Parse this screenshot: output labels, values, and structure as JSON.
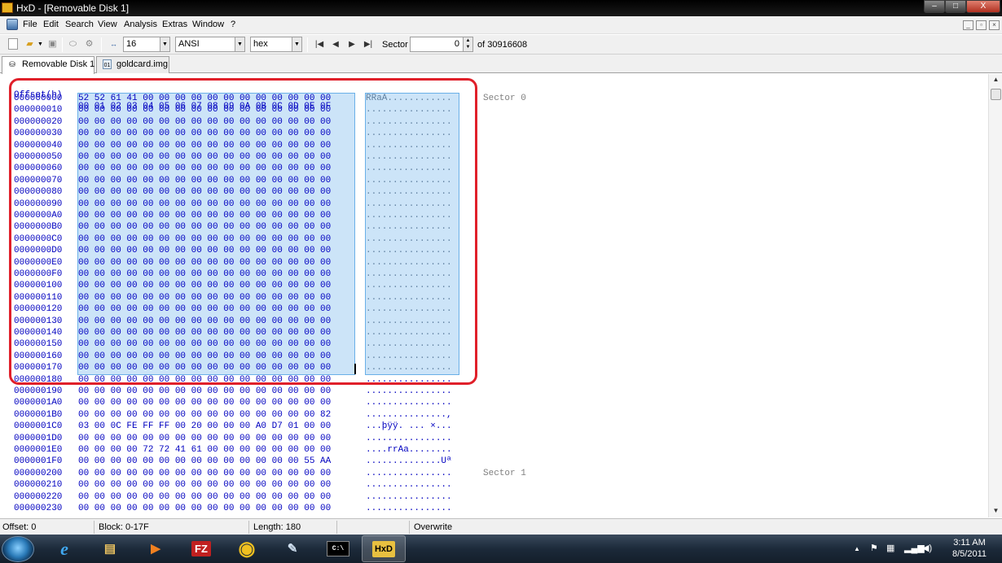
{
  "window": {
    "title": "HxD - [Removable Disk 1]",
    "icon_text": "HxD",
    "minimize": "–",
    "maximize": "□",
    "close": "X"
  },
  "menu": {
    "items": [
      "File",
      "Edit",
      "Search",
      "View",
      "Analysis",
      "Extras",
      "Window",
      "?"
    ]
  },
  "toolbar": {
    "bytes_per_row": "16",
    "charset": "ANSI",
    "offset_base": "hex",
    "sector_label": "Sector",
    "sector_value": "0",
    "sector_total": "of 30916608"
  },
  "tabs": [
    {
      "label": "Removable Disk 1",
      "active": true
    },
    {
      "label": "goldcard.img",
      "active": false
    }
  ],
  "editor": {
    "header_offset": "Offset(h)",
    "header_columns": "00 01 02 03 04 05 06 07 08 09 0A 0B 0C 0D 0E 0F",
    "rows": [
      {
        "offset": "000000000",
        "hex": "52 52 61 41 00 00 00 00 00 00 00 00 00 00 00 00",
        "text": "RRaA............"
      },
      {
        "offset": "000000010",
        "hex": "00 00 00 00 00 00 00 00 00 00 00 00 00 00 00 00",
        "text": "................"
      },
      {
        "offset": "000000020",
        "hex": "00 00 00 00 00 00 00 00 00 00 00 00 00 00 00 00",
        "text": "................"
      },
      {
        "offset": "000000030",
        "hex": "00 00 00 00 00 00 00 00 00 00 00 00 00 00 00 00",
        "text": "................"
      },
      {
        "offset": "000000040",
        "hex": "00 00 00 00 00 00 00 00 00 00 00 00 00 00 00 00",
        "text": "................"
      },
      {
        "offset": "000000050",
        "hex": "00 00 00 00 00 00 00 00 00 00 00 00 00 00 00 00",
        "text": "................"
      },
      {
        "offset": "000000060",
        "hex": "00 00 00 00 00 00 00 00 00 00 00 00 00 00 00 00",
        "text": "................"
      },
      {
        "offset": "000000070",
        "hex": "00 00 00 00 00 00 00 00 00 00 00 00 00 00 00 00",
        "text": "................"
      },
      {
        "offset": "000000080",
        "hex": "00 00 00 00 00 00 00 00 00 00 00 00 00 00 00 00",
        "text": "................"
      },
      {
        "offset": "000000090",
        "hex": "00 00 00 00 00 00 00 00 00 00 00 00 00 00 00 00",
        "text": "................"
      },
      {
        "offset": "0000000A0",
        "hex": "00 00 00 00 00 00 00 00 00 00 00 00 00 00 00 00",
        "text": "................"
      },
      {
        "offset": "0000000B0",
        "hex": "00 00 00 00 00 00 00 00 00 00 00 00 00 00 00 00",
        "text": "................"
      },
      {
        "offset": "0000000C0",
        "hex": "00 00 00 00 00 00 00 00 00 00 00 00 00 00 00 00",
        "text": "................"
      },
      {
        "offset": "0000000D0",
        "hex": "00 00 00 00 00 00 00 00 00 00 00 00 00 00 00 00",
        "text": "................"
      },
      {
        "offset": "0000000E0",
        "hex": "00 00 00 00 00 00 00 00 00 00 00 00 00 00 00 00",
        "text": "................"
      },
      {
        "offset": "0000000F0",
        "hex": "00 00 00 00 00 00 00 00 00 00 00 00 00 00 00 00",
        "text": "................"
      },
      {
        "offset": "000000100",
        "hex": "00 00 00 00 00 00 00 00 00 00 00 00 00 00 00 00",
        "text": "................"
      },
      {
        "offset": "000000110",
        "hex": "00 00 00 00 00 00 00 00 00 00 00 00 00 00 00 00",
        "text": "................"
      },
      {
        "offset": "000000120",
        "hex": "00 00 00 00 00 00 00 00 00 00 00 00 00 00 00 00",
        "text": "................"
      },
      {
        "offset": "000000130",
        "hex": "00 00 00 00 00 00 00 00 00 00 00 00 00 00 00 00",
        "text": "................"
      },
      {
        "offset": "000000140",
        "hex": "00 00 00 00 00 00 00 00 00 00 00 00 00 00 00 00",
        "text": "................"
      },
      {
        "offset": "000000150",
        "hex": "00 00 00 00 00 00 00 00 00 00 00 00 00 00 00 00",
        "text": "................"
      },
      {
        "offset": "000000160",
        "hex": "00 00 00 00 00 00 00 00 00 00 00 00 00 00 00 00",
        "text": "................"
      },
      {
        "offset": "000000170",
        "hex": "00 00 00 00 00 00 00 00 00 00 00 00 00 00 00 00",
        "text": "................"
      },
      {
        "offset": "000000180",
        "hex": "00 00 00 00 00 00 00 00 00 00 00 00 00 00 00 00",
        "text": "................"
      },
      {
        "offset": "000000190",
        "hex": "00 00 00 00 00 00 00 00 00 00 00 00 00 00 00 00",
        "text": "................"
      },
      {
        "offset": "0000001A0",
        "hex": "00 00 00 00 00 00 00 00 00 00 00 00 00 00 00 00",
        "text": "................"
      },
      {
        "offset": "0000001B0",
        "hex": "00 00 00 00 00 00 00 00 00 00 00 00 00 00 00 82",
        "text": "...............,"
      },
      {
        "offset": "0000001C0",
        "hex": "03 00 0C FE FF FF 00 20 00 00 00 A0 D7 01 00 00",
        "text": "...þÿÿ. ... ×..."
      },
      {
        "offset": "0000001D0",
        "hex": "00 00 00 00 00 00 00 00 00 00 00 00 00 00 00 00",
        "text": "................"
      },
      {
        "offset": "0000001E0",
        "hex": "00 00 00 00 72 72 41 61 00 00 00 00 00 00 00 00",
        "text": "....rrAa........"
      },
      {
        "offset": "0000001F0",
        "hex": "00 00 00 00 00 00 00 00 00 00 00 00 00 00 55 AA",
        "text": "..............Uª"
      },
      {
        "offset": "000000200",
        "hex": "00 00 00 00 00 00 00 00 00 00 00 00 00 00 00 00",
        "text": "................"
      },
      {
        "offset": "000000210",
        "hex": "00 00 00 00 00 00 00 00 00 00 00 00 00 00 00 00",
        "text": "................"
      },
      {
        "offset": "000000220",
        "hex": "00 00 00 00 00 00 00 00 00 00 00 00 00 00 00 00",
        "text": "................"
      },
      {
        "offset": "000000230",
        "hex": "00 00 00 00 00 00 00 00 00 00 00 00 00 00 00 00",
        "text": "................"
      }
    ],
    "sector_labels": {
      "s0": "Sector 0",
      "s1": "Sector 1"
    }
  },
  "status": {
    "offset": "Offset: 0",
    "block": "Block: 0-17F",
    "length": "Length: 180",
    "mode": "Overwrite"
  },
  "taskbar": {
    "apps": [
      "ie",
      "explorer",
      "media-player",
      "filezilla",
      "chrome",
      "paint",
      "cmd",
      "hxd"
    ],
    "app_glyphs": [
      "e",
      "▤",
      "▶",
      "FZ",
      "◉",
      "✎",
      "C:\\",
      "HxD"
    ],
    "active_app": "hxd",
    "time": "3:11 AM",
    "date": "8/5/2011",
    "tray_up_arrow": "▲"
  },
  "colors": {
    "selection": "#cce4f8",
    "annotation": "#e0202a",
    "hex_text": "#0000c0"
  }
}
